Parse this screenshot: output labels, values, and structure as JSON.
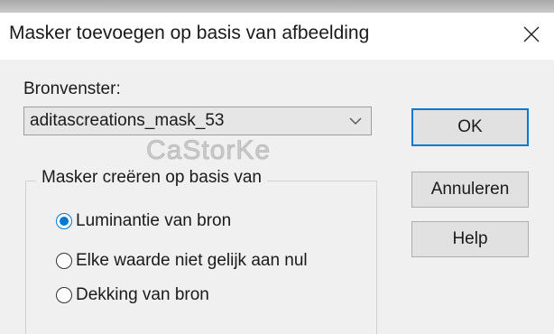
{
  "dialog": {
    "title": "Masker toevoegen op basis van afbeelding"
  },
  "source": {
    "label": "Bronvenster:",
    "selected": "aditascreations_mask_53"
  },
  "group": {
    "legend": "Masker creëren op basis van",
    "options": [
      {
        "label": "Luminantie van bron",
        "checked": true
      },
      {
        "label": "Elke waarde niet gelijk aan nul",
        "checked": false
      },
      {
        "label": "Dekking van bron",
        "checked": false
      }
    ]
  },
  "buttons": {
    "ok": "OK",
    "cancel": "Annuleren",
    "help": "Help"
  },
  "watermark": "CaStorKe",
  "colors": {
    "accent": "#0078d7",
    "dialog_bg": "#f0f0f0",
    "title_bg": "#ffffff"
  }
}
